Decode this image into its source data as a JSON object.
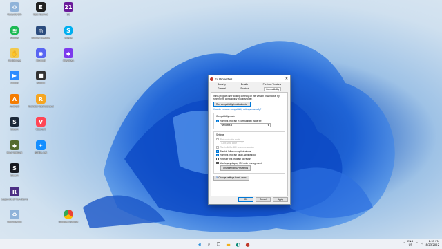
{
  "desktop_icons": [
    {
      "label": "Recycle Bin",
      "icon": "recycle-bin-icon",
      "color": "#8fb3d9"
    },
    {
      "label": "Spotify",
      "icon": "spotify-icon",
      "color": "#1db954"
    },
    {
      "label": "Clubhouse",
      "icon": "clubhouse-icon",
      "color": "#f2c94c"
    },
    {
      "label": "Zooon",
      "icon": "zoom-icon",
      "color": "#2d8cff"
    },
    {
      "label": "Android",
      "icon": "android-icon",
      "color": "#f57c00"
    },
    {
      "label": "Steam",
      "icon": "steam-icon",
      "color": "#1b2838"
    },
    {
      "label": "Soul Vigilant",
      "icon": "game-icon",
      "color": "#556b2f"
    },
    {
      "label": "Steam",
      "icon": "steam-icon",
      "color": "#171a21"
    },
    {
      "label": "Legends of Runeterra",
      "icon": "game-icon",
      "color": "#4b2e83"
    },
    {
      "label": "Recycle Bin",
      "icon": "recycle-bin-icon",
      "color": "#8fb3d9"
    },
    {
      "label": "Epic Games",
      "icon": "epic-icon",
      "color": "#222222"
    },
    {
      "label": "Rocket League",
      "icon": "game-icon",
      "color": "#2b4c7e"
    },
    {
      "label": "Discord",
      "icon": "discord-icon",
      "color": "#5865f2"
    },
    {
      "label": "Roblox",
      "icon": "roblox-icon",
      "color": "#333333"
    },
    {
      "label": "Rockstar Games Launcher",
      "icon": "rockstar-icon",
      "color": "#f5a623"
    },
    {
      "label": "Valorant",
      "icon": "valorant-icon",
      "color": "#ff4655"
    },
    {
      "label": "Battle.net",
      "icon": "battlenet-icon",
      "color": "#148eff"
    },
    {
      "label": "21",
      "icon": "game-icon",
      "color": "#6a1b9a"
    },
    {
      "label": "Skype",
      "icon": "skype-icon",
      "color": "#00aff0"
    },
    {
      "label": "Obsidian",
      "icon": "obsidian-icon",
      "color": "#7c3aed"
    },
    {
      "label": "Google Chrome",
      "icon": "chrome-icon",
      "color": "#fbbc05"
    }
  ],
  "dialog": {
    "title": "E4 Properties",
    "close": "✕",
    "tabs_row1": [
      "Security",
      "Details",
      "Previous Versions"
    ],
    "tabs_row2": [
      "General",
      "Shortcut",
      "Compatibility"
    ],
    "intro": "If this program isn't working correctly on this version of Windows, try running the compatibility troubleshooter.",
    "troubleshooter_button": "Run compatibility troubleshooter",
    "manual_link": "How do I choose compatibility settings manually?",
    "compat_mode_title": "Compatibility mode",
    "compat_mode_checkbox": "Run this program in compatibility mode for:",
    "compat_mode_value": "Windows 8",
    "settings_title": "Settings",
    "reduced_color": "Reduced color mode",
    "color_value": "8-bit (256) color",
    "run_640": "Run in 640 x 480 screen resolution",
    "disable_fullscreen": "Disable fullscreen optimizations",
    "run_admin": "Run this program as an administrator",
    "register_restart": "Register this program for restart",
    "legacy_icc": "Use legacy display ICC color management",
    "dpi_button": "Change high DPI settings",
    "all_users_button": "Change settings for all users",
    "ok": "OK",
    "cancel": "Cancel",
    "apply": "Apply"
  },
  "taskbar": {
    "lang_line1": "ENG",
    "lang_line2": "US",
    "time": "2:35 PM",
    "date": "8/23/2022"
  }
}
